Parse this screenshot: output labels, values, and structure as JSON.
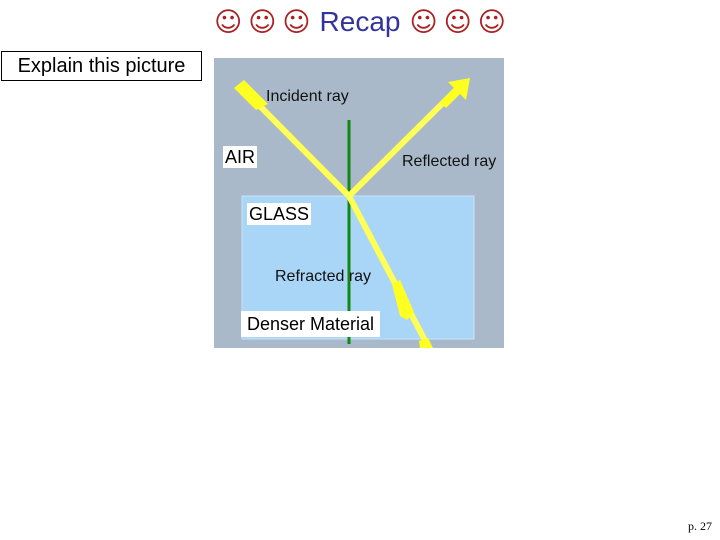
{
  "slide": {
    "title": {
      "smileys_left": [
        "☺",
        "☺",
        "☺"
      ],
      "text": "Recap",
      "smileys_right": [
        "☺",
        "☺",
        "☺"
      ]
    },
    "prompt_box": "Explain this picture",
    "figure": {
      "diagram_labels": {
        "incident": "Incident ray",
        "reflected": "Reflected ray",
        "refracted": "Refracted ray"
      },
      "overlay_labels": {
        "air": "AIR",
        "glass": "GLASS",
        "denser": "Denser Material"
      },
      "colors": {
        "air_background": "#a9b9c9",
        "glass": "#a9d6f7",
        "ray": "#ffff22",
        "normal_line": "#118811"
      }
    },
    "page_number": "p. 27"
  }
}
